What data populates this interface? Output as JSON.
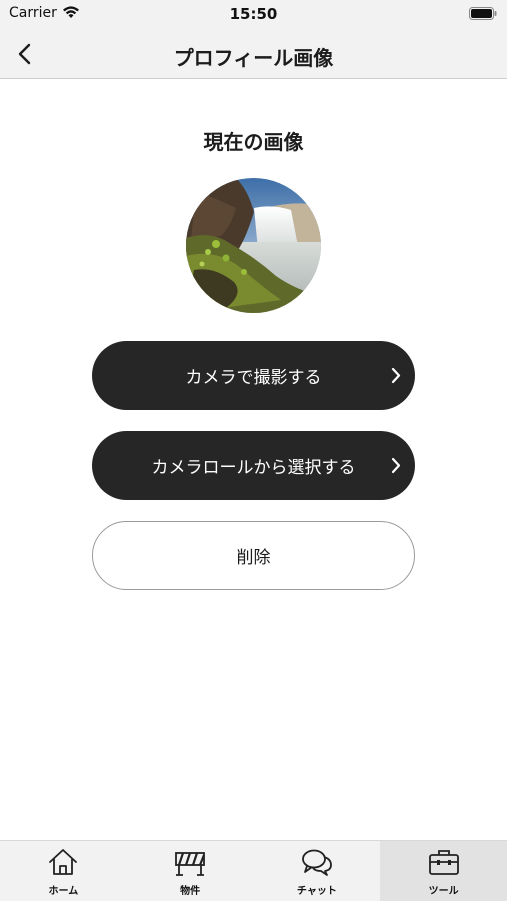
{
  "status_bar": {
    "carrier": "Carrier",
    "time": "15:50"
  },
  "nav": {
    "title": "プロフィール画像",
    "back_icon": "chevron-left-icon"
  },
  "content": {
    "section_title": "現在の画像",
    "avatar": {
      "description_icon": "waterfall-photo"
    },
    "buttons": {
      "camera": "カメラで撮影する",
      "camera_roll": "カメラロールから選択する",
      "delete": "削除"
    }
  },
  "tab_bar": {
    "items": [
      {
        "label": "ホーム",
        "icon": "home-icon"
      },
      {
        "label": "物件",
        "icon": "property-icon"
      },
      {
        "label": "チャット",
        "icon": "chat-icon"
      },
      {
        "label": "ツール",
        "icon": "toolbox-icon"
      }
    ],
    "active_index": 3
  },
  "colors": {
    "primary_button": "#262626",
    "bar_background": "#f2f2f2",
    "active_tab": "#e2e2e2"
  }
}
